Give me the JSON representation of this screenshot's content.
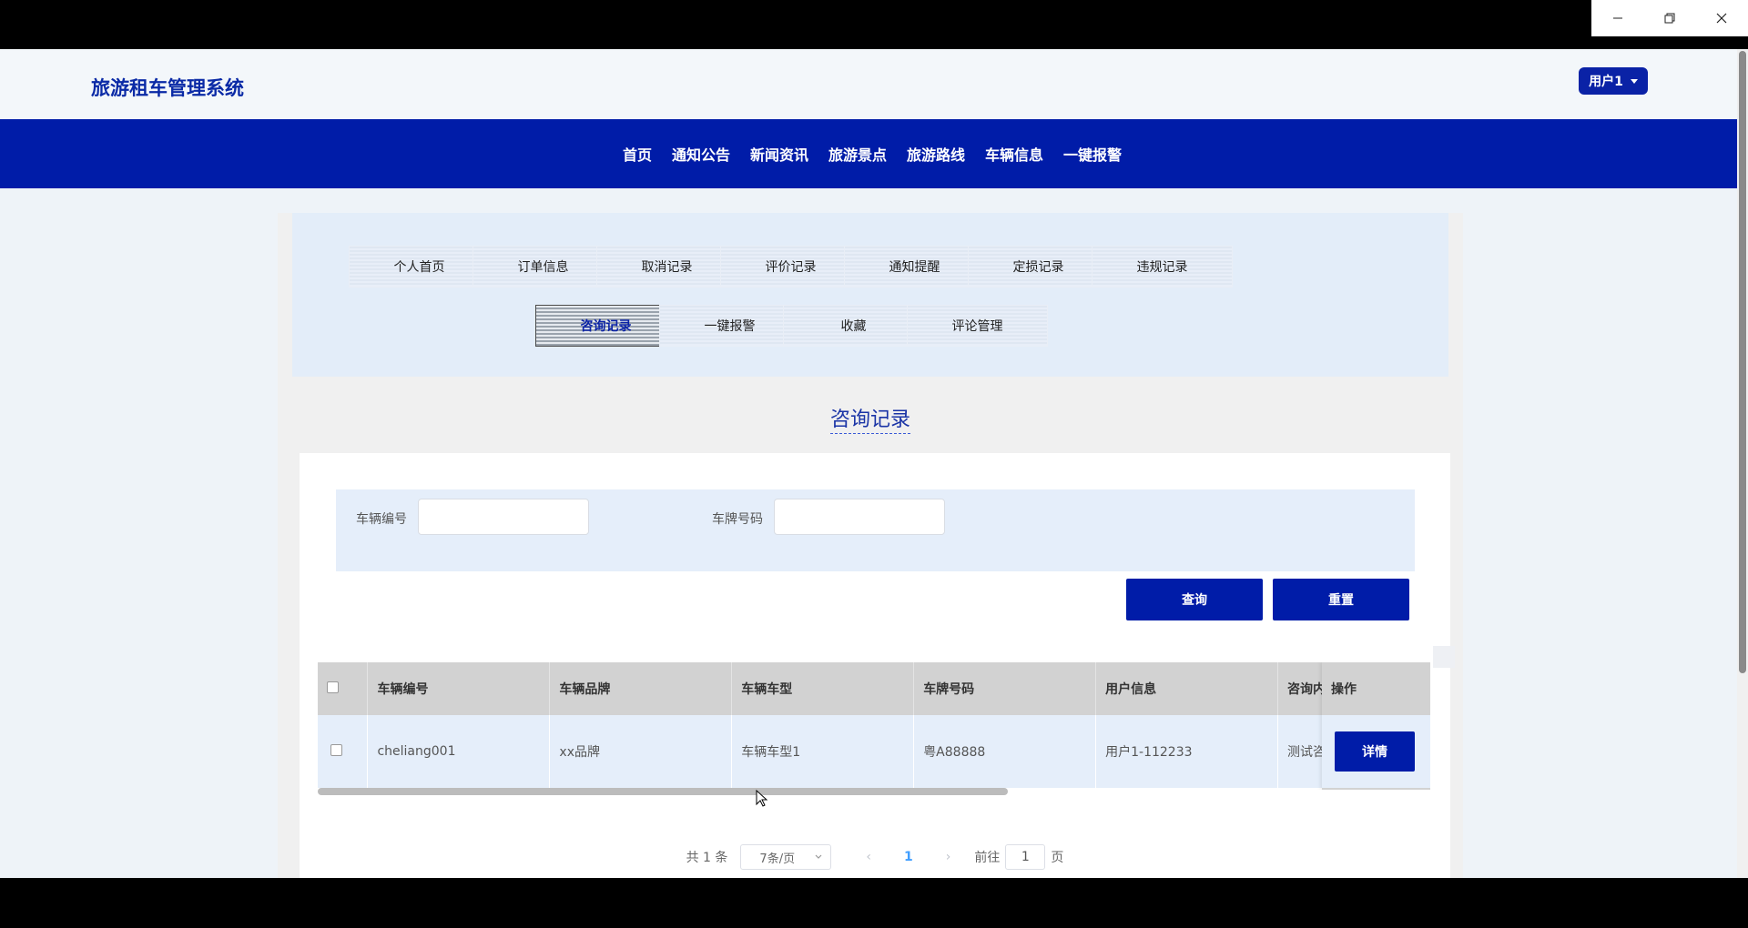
{
  "window": {
    "controls": [
      "minimize",
      "restore",
      "close"
    ]
  },
  "header": {
    "logo": "旅游租车管理系统",
    "user_label": "用户1"
  },
  "nav": {
    "items": [
      "首页",
      "通知公告",
      "新闻资讯",
      "旅游景点",
      "旅游路线",
      "车辆信息",
      "一键报警"
    ]
  },
  "tabs": {
    "row1": [
      "个人首页",
      "订单信息",
      "取消记录",
      "评价记录",
      "通知提醒",
      "定损记录",
      "违规记录"
    ],
    "row2": [
      "咨询记录",
      "一键报警",
      "收藏",
      "评论管理"
    ],
    "active": "咨询记录"
  },
  "page": {
    "title": "咨询记录"
  },
  "search": {
    "vehicle_no_label": "车辆编号",
    "vehicle_no_value": "",
    "plate_label": "车牌号码",
    "plate_value": "",
    "query_label": "查询",
    "reset_label": "重置"
  },
  "table": {
    "headers": [
      "车辆编号",
      "车辆品牌",
      "车辆车型",
      "车牌号码",
      "用户信息",
      "咨询内"
    ],
    "op_header": "操作",
    "rows": [
      {
        "cells": [
          "cheliang001",
          "xx品牌",
          "车辆车型1",
          "粤A88888",
          "用户1-112233",
          "测试咨"
        ],
        "detail_label": "详情"
      }
    ]
  },
  "pagination": {
    "total": "共 1 条",
    "page_size": "7条/页",
    "current_page": "1",
    "goto_prefix": "前往",
    "goto_value": "1",
    "goto_suffix": "页"
  },
  "colors": {
    "brand": "#001ca8",
    "logo": "#0a2aa6",
    "active_page": "#409eff"
  }
}
